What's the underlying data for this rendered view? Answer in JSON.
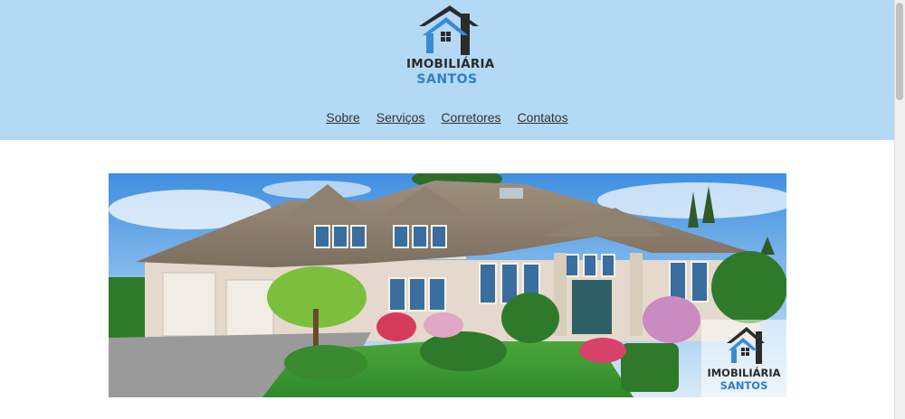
{
  "brand": {
    "name_line1": "IMOBILIÁRIA",
    "name_line2": "SANTOS",
    "colors": {
      "dark": "#2b2b2b",
      "blue": "#2f7fc9",
      "header_bg": "#b3d9f5"
    }
  },
  "nav": {
    "items": [
      {
        "label": "Sobre"
      },
      {
        "label": "Serviços"
      },
      {
        "label": "Corretores"
      },
      {
        "label": "Contatos"
      }
    ]
  },
  "hero": {
    "watermark_line1": "IMOBILIÁRIA",
    "watermark_line2": "SANTOS"
  },
  "icons": [
    "house-logo-icon",
    "watermark-logo-icon"
  ]
}
